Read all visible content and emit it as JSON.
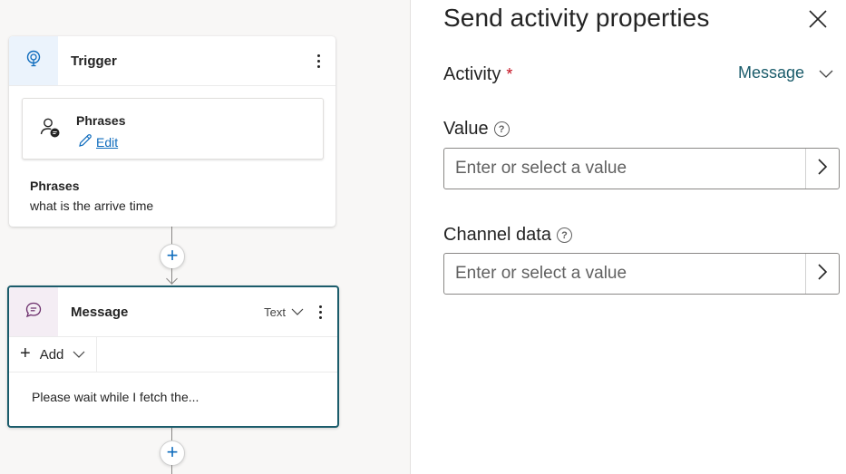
{
  "canvas": {
    "trigger_card": {
      "title": "Trigger",
      "phrases_box": {
        "title": "Phrases",
        "edit_label": "Edit"
      },
      "phrases_label": "Phrases",
      "phrases_value": "what is the arrive time"
    },
    "message_card": {
      "title": "Message",
      "type_label": "Text",
      "add_label": "Add",
      "preview_text": "Please wait while I fetch the..."
    }
  },
  "panel": {
    "title": "Send activity properties",
    "activity": {
      "label": "Activity",
      "required_mark": "*",
      "selected": "Message"
    },
    "value": {
      "label": "Value",
      "help": "?",
      "placeholder": "Enter or select a value"
    },
    "channel_data": {
      "label": "Channel data",
      "help": "?",
      "placeholder": "Enter or select a value"
    }
  },
  "colors": {
    "accent_teal": "#1b5c6b",
    "link_blue": "#0f6cbd",
    "required_red": "#c50f1f",
    "canvas_bg": "#f8f7f6",
    "trigger_icon_bg": "#ebf3fc",
    "message_icon_bg": "#f4edf4"
  },
  "icons": {
    "trigger": "lightbulb-icon",
    "phrases": "person-chat-icon",
    "edit": "pencil-icon",
    "message": "chat-bubble-icon",
    "close": "dismiss-icon",
    "chevron": "chevron-down-icon",
    "input_chevron": "chevron-right-icon",
    "help": "question-circle-icon"
  }
}
